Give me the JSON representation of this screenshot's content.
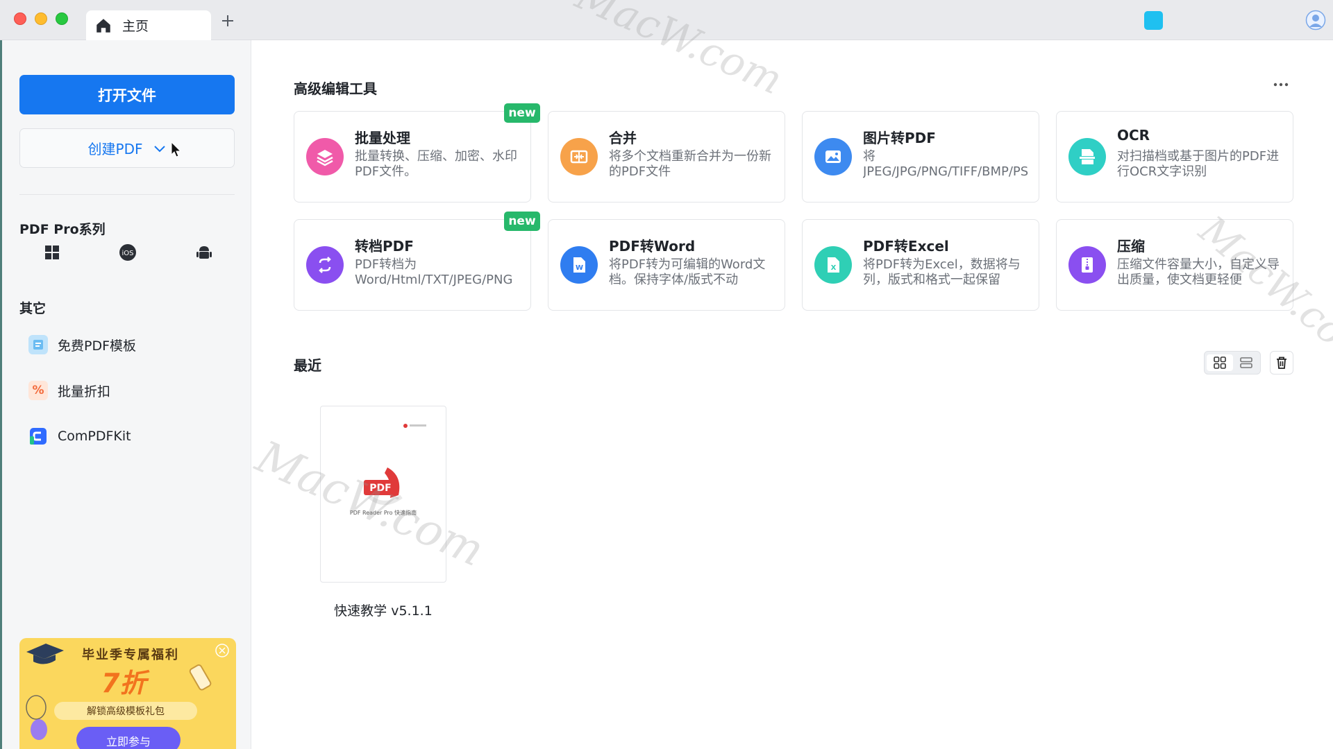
{
  "window": {
    "tab_label": "主页"
  },
  "sidebar": {
    "open_file_label": "打开文件",
    "create_pdf_label": "创建PDF",
    "series_title": "PDF Pro系列",
    "platforms": [
      "windows-icon",
      "ios-icon",
      "android-icon"
    ],
    "others_title": "其它",
    "other_items": [
      {
        "label": "免费PDF模板",
        "icon": "template-icon"
      },
      {
        "label": "批量折扣",
        "icon": "discount-icon"
      },
      {
        "label": "ComPDFKit",
        "icon": "compdfkit-icon"
      }
    ],
    "promo": {
      "headline": "毕业季专属福利",
      "discount": "7折",
      "unlock_text": "解锁高级模板礼包",
      "cta_label": "立即参与"
    }
  },
  "tools": {
    "title": "高级编辑工具",
    "items": [
      {
        "title": "批量处理",
        "desc": "批量转换、压缩、加密、水印PDF文件。",
        "badge": "new",
        "icon": "batch-icon",
        "color": "#f05aa9"
      },
      {
        "title": "合并",
        "desc": "将多个文档重新合并为一份新的PDF文件",
        "badge": "",
        "icon": "merge-icon",
        "color": "#f7a24a"
      },
      {
        "title": "图片转PDF",
        "desc": "将JPEG/JPG/PNG/TIFF/BMP/PSD等图片格式转...",
        "badge": "",
        "icon": "image-icon",
        "color": "#3d8af0"
      },
      {
        "title": "OCR",
        "desc": "对扫描档或基于图片的PDF进行OCR文字识别",
        "badge": "",
        "icon": "ocr-icon",
        "color": "#2fcfc5"
      },
      {
        "title": "转档PDF",
        "desc": "PDF转档为Word/Html/TXT/JPEG/PNG格式",
        "badge": "new",
        "icon": "convert-icon",
        "color": "#8a4ff0"
      },
      {
        "title": "PDF转Word",
        "desc": "将PDF转为可编辑的Word文档。保持字体/版式不动",
        "badge": "",
        "icon": "word-icon",
        "color": "#2f7df0"
      },
      {
        "title": "PDF转Excel",
        "desc": "将PDF转为Excel，数据将与列，版式和格式一起保留",
        "badge": "",
        "icon": "excel-icon",
        "color": "#2fcfb5"
      },
      {
        "title": "压缩",
        "desc": "压缩文件容量大小，自定义导出质量，使文档更轻便",
        "badge": "",
        "icon": "compress-icon",
        "color": "#8a4ff0"
      }
    ]
  },
  "recent": {
    "title": "最近",
    "files": [
      {
        "name": "快速教学 v5.1.1",
        "thumb_logo": "PDF",
        "thumb_caption": "PDF Reader Pro 快速指南"
      }
    ]
  },
  "watermark": "MacW.com"
}
